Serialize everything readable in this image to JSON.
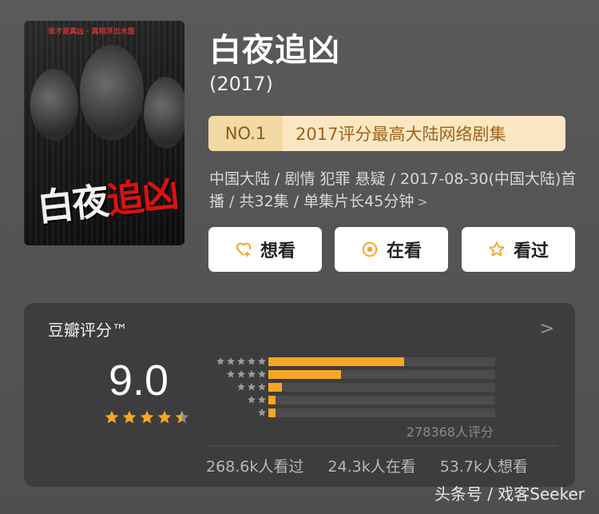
{
  "poster": {
    "tagline": "谁才是真凶 · 真相浮出水面",
    "title_part1": "白夜",
    "title_part2": "追凶"
  },
  "show": {
    "title": "白夜追凶",
    "year": "(2017)"
  },
  "rank_badge": {
    "no": "NO.1",
    "desc": "2017评分最高大陆网络剧集"
  },
  "meta": {
    "line": "中国大陆 / 剧情 犯罪 悬疑 / 2017-08-30(中国大陆)首播 / 共32集 / 单集片长45分钟"
  },
  "actions": {
    "want_label": "想看",
    "watching_label": "在看",
    "watched_label": "看过"
  },
  "rating": {
    "card_title": "豆瓣评分™",
    "score": "9.0",
    "score_stars": 4.5,
    "rating_count": "278368人评分",
    "distribution": [
      {
        "stars": 5,
        "fraction": 0.6
      },
      {
        "stars": 4,
        "fraction": 0.32
      },
      {
        "stars": 3,
        "fraction": 0.06
      },
      {
        "stars": 2,
        "fraction": 0.03
      },
      {
        "stars": 1,
        "fraction": 0.03
      }
    ],
    "watched": "268.6k人看过",
    "watching": "24.3k人在看",
    "want": "53.7k人想看"
  },
  "watermark": "头条号 / 戏客Seeker",
  "colors": {
    "accent": "#f6a623",
    "badge_no_bg": "#f3d9a3",
    "badge_desc_bg": "#fbe8c2",
    "card_bg": "#3d3d3d"
  }
}
